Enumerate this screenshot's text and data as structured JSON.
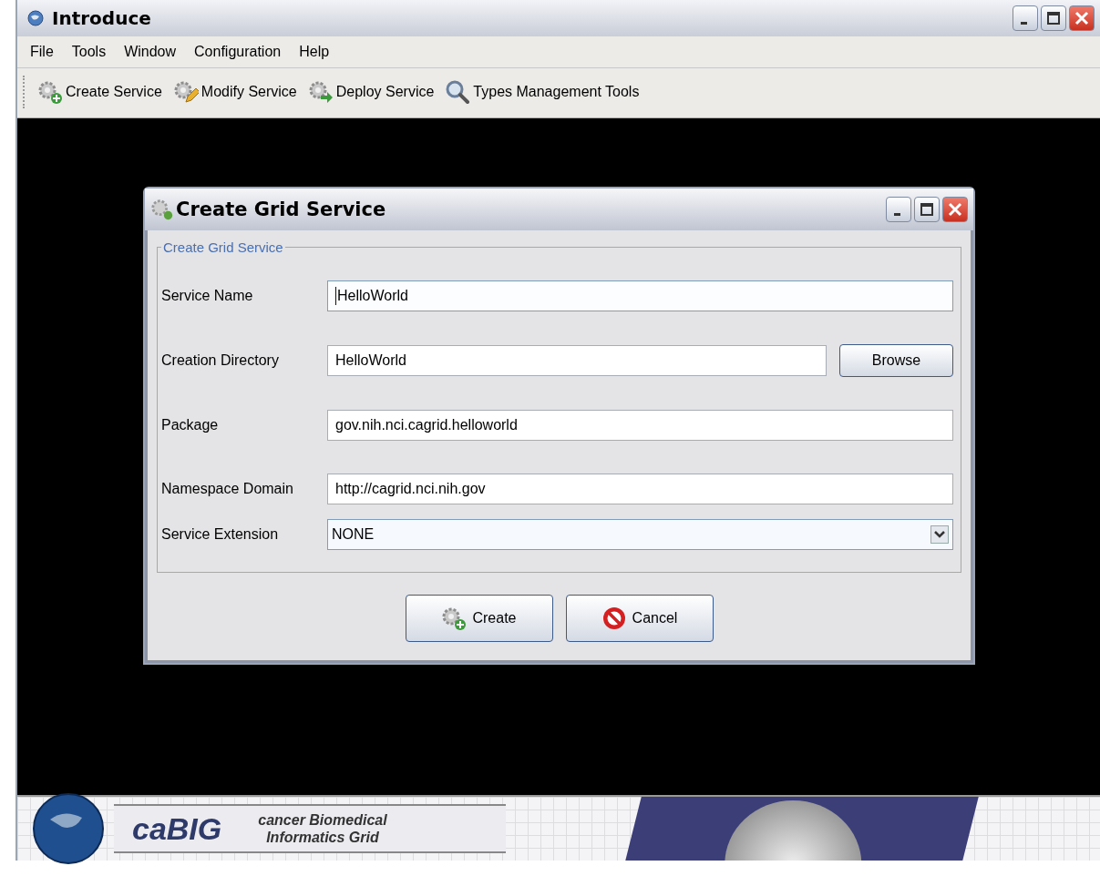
{
  "window": {
    "title": "Introduce"
  },
  "menu": [
    "File",
    "Tools",
    "Window",
    "Configuration",
    "Help"
  ],
  "toolbar": [
    {
      "label": "Create Service",
      "kind": "create"
    },
    {
      "label": "Modify Service",
      "kind": "modify"
    },
    {
      "label": "Deploy Service",
      "kind": "deploy"
    },
    {
      "label": "Types Management Tools",
      "kind": "search"
    }
  ],
  "dialog": {
    "title": "Create Grid Service",
    "group_title": "Create Grid Service",
    "fields": [
      {
        "label": "Service Name",
        "value": "HelloWorld",
        "kind": "text",
        "focused": true
      },
      {
        "label": "Creation Directory",
        "value": "HelloWorld",
        "kind": "browse",
        "button": "Browse",
        "focused": false
      },
      {
        "label": "Package",
        "value": "gov.nih.nci.cagrid.helloworld",
        "kind": "text",
        "focused": false
      },
      {
        "label": "Namespace Domain",
        "value": "http://cagrid.nci.nih.gov",
        "kind": "text",
        "focused": false
      },
      {
        "label": "Service Extension",
        "value": "NONE",
        "kind": "dropdown",
        "focused": false
      }
    ],
    "buttons": [
      {
        "label": "Create",
        "kind": "create"
      },
      {
        "label": "Cancel",
        "kind": "cancel"
      }
    ]
  },
  "banner": {
    "logo": "caBIG",
    "tagline_1": "cancer Biomedical",
    "tagline_2": "Informatics Grid"
  }
}
